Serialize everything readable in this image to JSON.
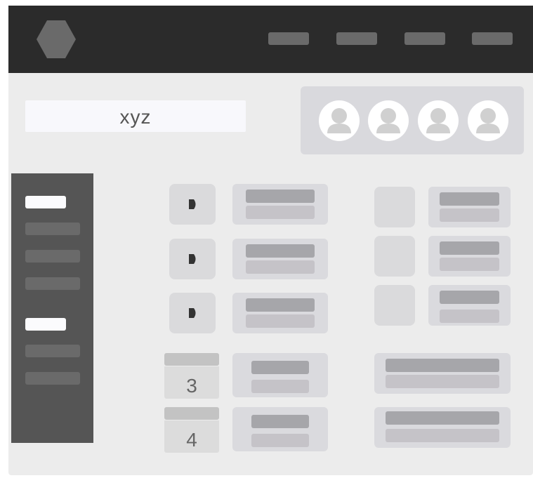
{
  "search": {
    "value": "xyz"
  },
  "rows": [
    {
      "label": "3"
    },
    {
      "label": "4"
    }
  ],
  "icons": {
    "logo": "hexagon-logo-icon",
    "avatar": "user-avatar-icon",
    "play": "play-icon"
  },
  "colors": {
    "topbar": "#2b2b2b",
    "content_bg": "#ececec",
    "sidebar": "#555555",
    "active_item": "#fbfbfd",
    "card": "#dadade"
  }
}
